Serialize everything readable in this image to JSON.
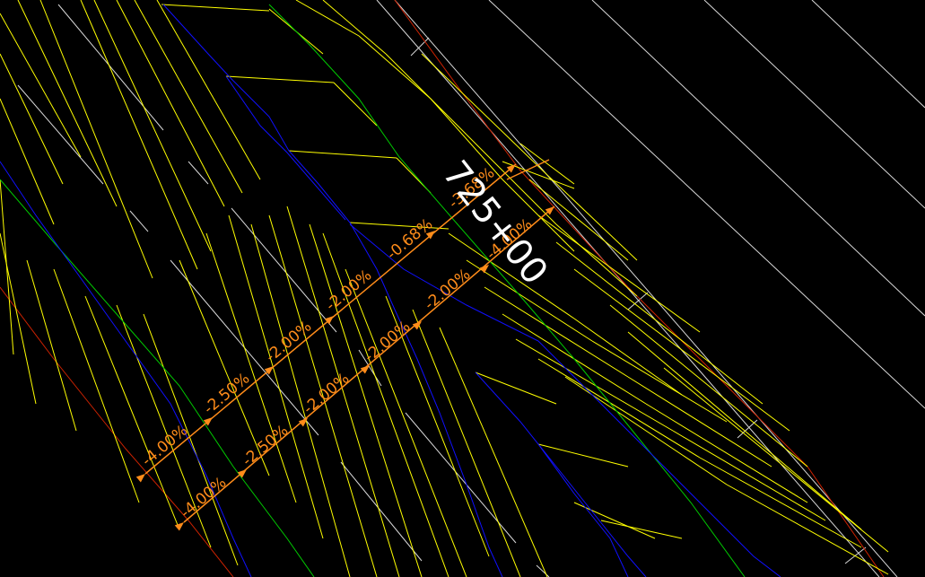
{
  "colors": {
    "background": "#000000",
    "yellow": "#ffff00",
    "blue": "#1010ff",
    "green": "#00cc00",
    "white": "#d8d8d8",
    "red": "#cc2200",
    "orange": "#ff8c1a",
    "station_text": "#ffffff"
  },
  "station_label": "725+00",
  "upper_row": [
    "-4.00%",
    "-2.50%",
    "-2.00%",
    "-2.00%",
    "-0.68%",
    "-3.68%"
  ],
  "lower_row": [
    "-4.00%",
    "-2.50%",
    "-2.00%",
    "-2.00%",
    "-2.00%",
    "-4.00%"
  ]
}
